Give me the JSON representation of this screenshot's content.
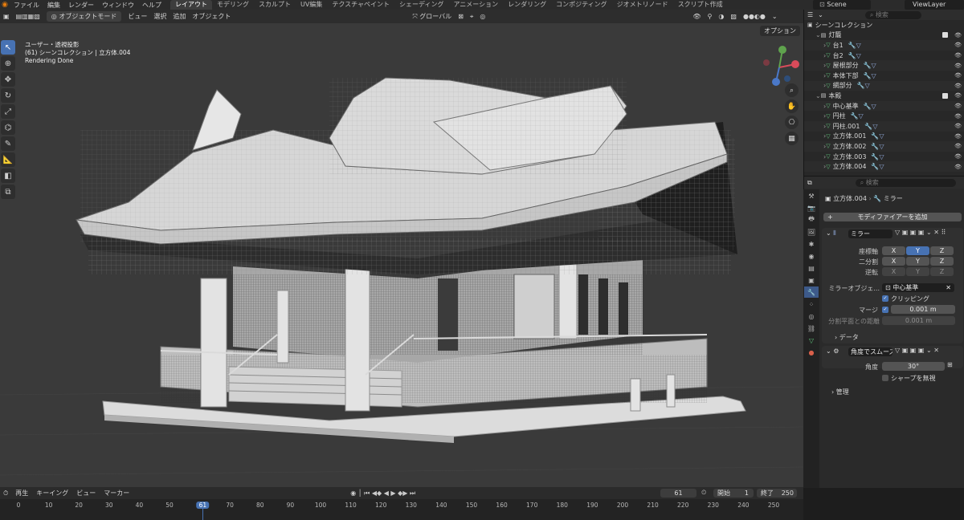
{
  "menu": {
    "logo_icon": "blender-logo-icon",
    "items": [
      "ファイル",
      "編集",
      "レンダー",
      "ウィンドウ",
      "ヘルプ"
    ]
  },
  "workspaces": [
    "レイアウト",
    "モデリング",
    "スカルプト",
    "UV編集",
    "テクスチャペイント",
    "シェーディング",
    "アニメーション",
    "レンダリング",
    "コンポジティング",
    "ジオメトリノード",
    "スクリプト作成"
  ],
  "scene": "Scene",
  "view_layer": "ViewLayer",
  "viewport_header": {
    "mode": "オブジェクトモード",
    "menus": [
      "ビュー",
      "選択",
      "追加",
      "オブジェクト"
    ],
    "transform_orientation": "グローバル",
    "options": "オプション"
  },
  "viewport_info": {
    "view": "ユーザー・透視投影",
    "collection": "(61) シーンコレクション | 立方体.004",
    "status": "Rendering Done"
  },
  "outliner": {
    "search_placeholder": "検索",
    "root": "シーンコレクション",
    "rows": [
      {
        "name": "灯籠",
        "type": "collection",
        "indent": 1
      },
      {
        "name": "台1",
        "type": "object",
        "indent": 2
      },
      {
        "name": "台2",
        "type": "object",
        "indent": 2
      },
      {
        "name": "屋根部分",
        "type": "object",
        "indent": 2
      },
      {
        "name": "本体下部",
        "type": "object",
        "indent": 2
      },
      {
        "name": "網部分",
        "type": "object",
        "indent": 2
      },
      {
        "name": "本殿",
        "type": "collection",
        "indent": 1
      },
      {
        "name": "中心基準",
        "type": "object",
        "indent": 2
      },
      {
        "name": "円柱",
        "type": "object",
        "indent": 2
      },
      {
        "name": "円柱.001",
        "type": "object",
        "indent": 2
      },
      {
        "name": "立方体.001",
        "type": "object",
        "indent": 2
      },
      {
        "name": "立方体.002",
        "type": "object",
        "indent": 2
      },
      {
        "name": "立方体.003",
        "type": "object",
        "indent": 2
      },
      {
        "name": "立方体.004",
        "type": "object",
        "indent": 2
      }
    ]
  },
  "properties": {
    "search_placeholder": "検索",
    "breadcrumb_object": "立方体.004",
    "breadcrumb_modifier": "ミラー",
    "add_modifier": "モディファイアーを追加",
    "mirror": {
      "name": "ミラー",
      "axis_label": "座標軸",
      "bisect_label": "二分割",
      "flip_label": "逆転",
      "axes": [
        "X",
        "Y",
        "Z"
      ],
      "mirror_object_label": "ミラーオブジェ...",
      "mirror_object": "中心基準",
      "clipping": "クリッピング",
      "merge_label": "マージ",
      "merge_value": "0.001 m",
      "bisect_distance_label": "分割平面との距離",
      "bisect_distance_value": "0.001 m",
      "data": "データ"
    },
    "smooth": {
      "name": "角度でスムーズ",
      "angle_label": "角度",
      "angle_value": "30°",
      "ignore_sharp": "シャープを無視",
      "manage": "管理"
    }
  },
  "timeline": {
    "menus": [
      "再生",
      "キーイング",
      "ビュー",
      "マーカー"
    ],
    "current_frame": "61",
    "start_label": "開始",
    "start": "1",
    "end_label": "終了",
    "end": "250",
    "ticks": [
      "0",
      "10",
      "20",
      "30",
      "40",
      "50",
      "61",
      "70",
      "80",
      "90",
      "100",
      "110",
      "120",
      "130",
      "140",
      "150",
      "160",
      "170",
      "180",
      "190",
      "200",
      "210",
      "220",
      "230",
      "240",
      "250"
    ]
  },
  "colors": {
    "accent": "#4772b3",
    "viewport_bg": "#3a3a3a",
    "object_icon": "#5fc47a",
    "collection_icon": "#cfcfcf",
    "playhead": "#4772b3"
  }
}
